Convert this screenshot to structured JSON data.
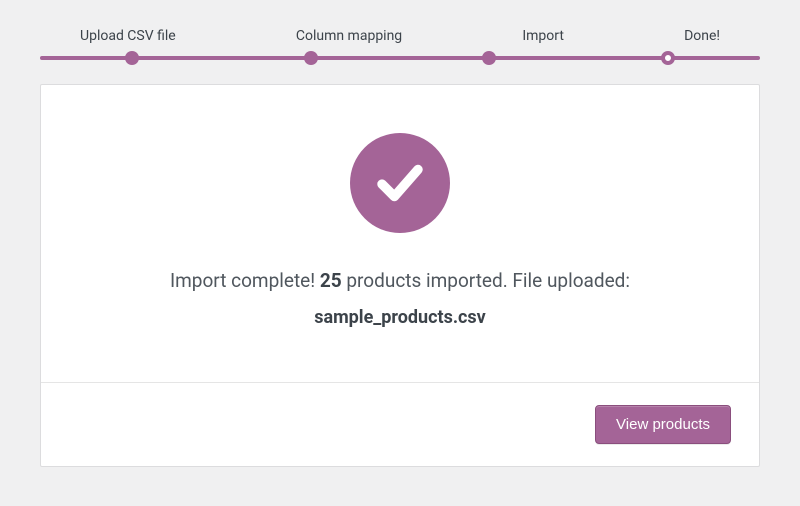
{
  "colors": {
    "accent": "#a46497"
  },
  "stepper": {
    "steps": [
      {
        "label": "Upload CSV file",
        "state": "complete"
      },
      {
        "label": "Column mapping",
        "state": "complete"
      },
      {
        "label": "Import",
        "state": "complete"
      },
      {
        "label": "Done!",
        "state": "active"
      }
    ]
  },
  "result": {
    "icon": "check-circle",
    "message_prefix": "Import complete! ",
    "count": "25",
    "message_mid": " products imported. File uploaded:",
    "filename": "sample_products.csv"
  },
  "actions": {
    "view_products_label": "View products"
  }
}
